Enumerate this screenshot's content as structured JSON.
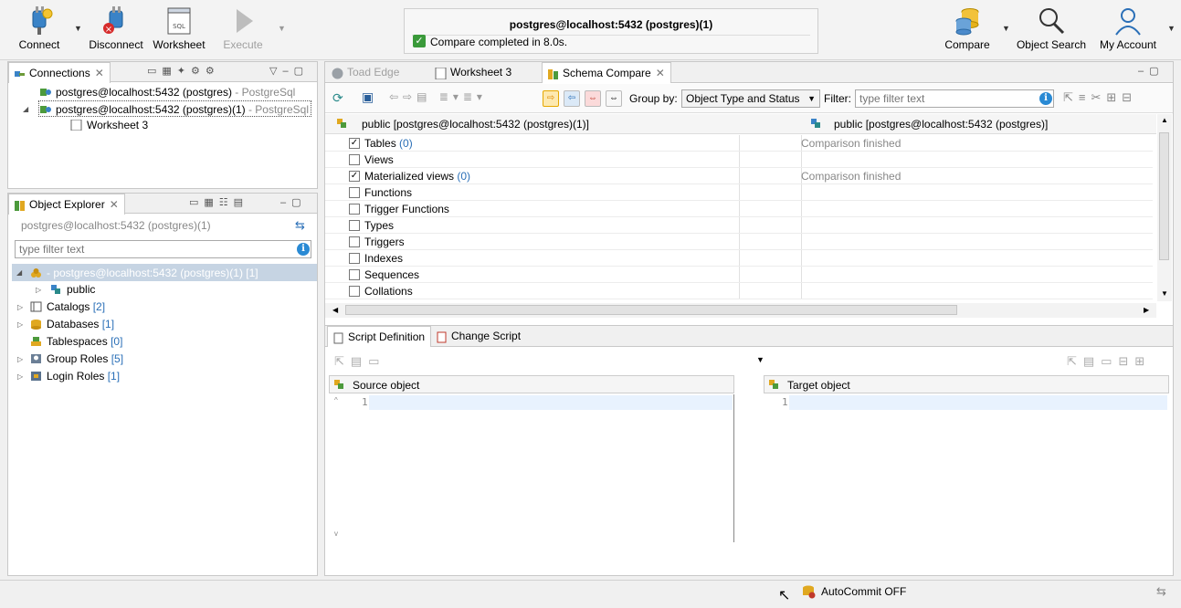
{
  "toolbar": {
    "connect": "Connect",
    "disconnect": "Disconnect",
    "worksheet": "Worksheet",
    "execute": "Execute",
    "compare": "Compare",
    "object_search": "Object Search",
    "my_account": "My Account"
  },
  "status": {
    "title": "postgres@localhost:5432 (postgres)(1)",
    "message": "Compare completed in 8.0s."
  },
  "connections": {
    "tab_label": "Connections",
    "items": [
      {
        "name": "postgres@localhost:5432 (postgres)",
        "type": " - PostgreSql"
      },
      {
        "name": "postgres@localhost:5432 (postgres)(1)",
        "type": " - PostgreSql"
      }
    ],
    "child": "Worksheet 3"
  },
  "explorer": {
    "tab_label": "Object Explorer",
    "connection": "postgres@localhost:5432 (postgres)(1)",
    "filter_placeholder": "type filter text",
    "root": "- postgres@localhost:5432 (postgres)(1) [1]",
    "schema": "public",
    "nodes": [
      {
        "label": "Catalogs",
        "count": "[2]"
      },
      {
        "label": "Databases",
        "count": "[1]"
      },
      {
        "label": "Tablespaces",
        "count": "[0]"
      },
      {
        "label": "Group Roles",
        "count": "[5]"
      },
      {
        "label": "Login Roles",
        "count": "[1]"
      }
    ]
  },
  "editor_tabs": {
    "toad_edge": "Toad Edge",
    "worksheet": "Worksheet 3",
    "schema_compare": "Schema Compare"
  },
  "compare_toolbar": {
    "group_by_label": "Group by:",
    "group_by_value": "Object Type and Status",
    "filter_label": "Filter:",
    "filter_placeholder": "type filter text"
  },
  "compare_grid": {
    "source_header": "public [postgres@localhost:5432 (postgres)(1)]",
    "target_header": "public [postgres@localhost:5432 (postgres)]",
    "rows": [
      {
        "label": "Tables",
        "count": "(0)",
        "checked": true,
        "status": "Comparison finished"
      },
      {
        "label": "Views",
        "count": "",
        "checked": false,
        "status": ""
      },
      {
        "label": "Materialized views",
        "count": "(0)",
        "checked": true,
        "status": "Comparison finished"
      },
      {
        "label": "Functions",
        "count": "",
        "checked": false,
        "status": ""
      },
      {
        "label": "Trigger Functions",
        "count": "",
        "checked": false,
        "status": ""
      },
      {
        "label": "Types",
        "count": "",
        "checked": false,
        "status": ""
      },
      {
        "label": "Triggers",
        "count": "",
        "checked": false,
        "status": ""
      },
      {
        "label": "Indexes",
        "count": "",
        "checked": false,
        "status": ""
      },
      {
        "label": "Sequences",
        "count": "",
        "checked": false,
        "status": ""
      },
      {
        "label": "Collations",
        "count": "",
        "checked": false,
        "status": ""
      }
    ]
  },
  "script_tabs": {
    "definition": "Script Definition",
    "change": "Change Script",
    "source_object": "Source object",
    "target_object": "Target object",
    "line_one": "1"
  },
  "statusbar": {
    "autocommit": "AutoCommit OFF"
  }
}
